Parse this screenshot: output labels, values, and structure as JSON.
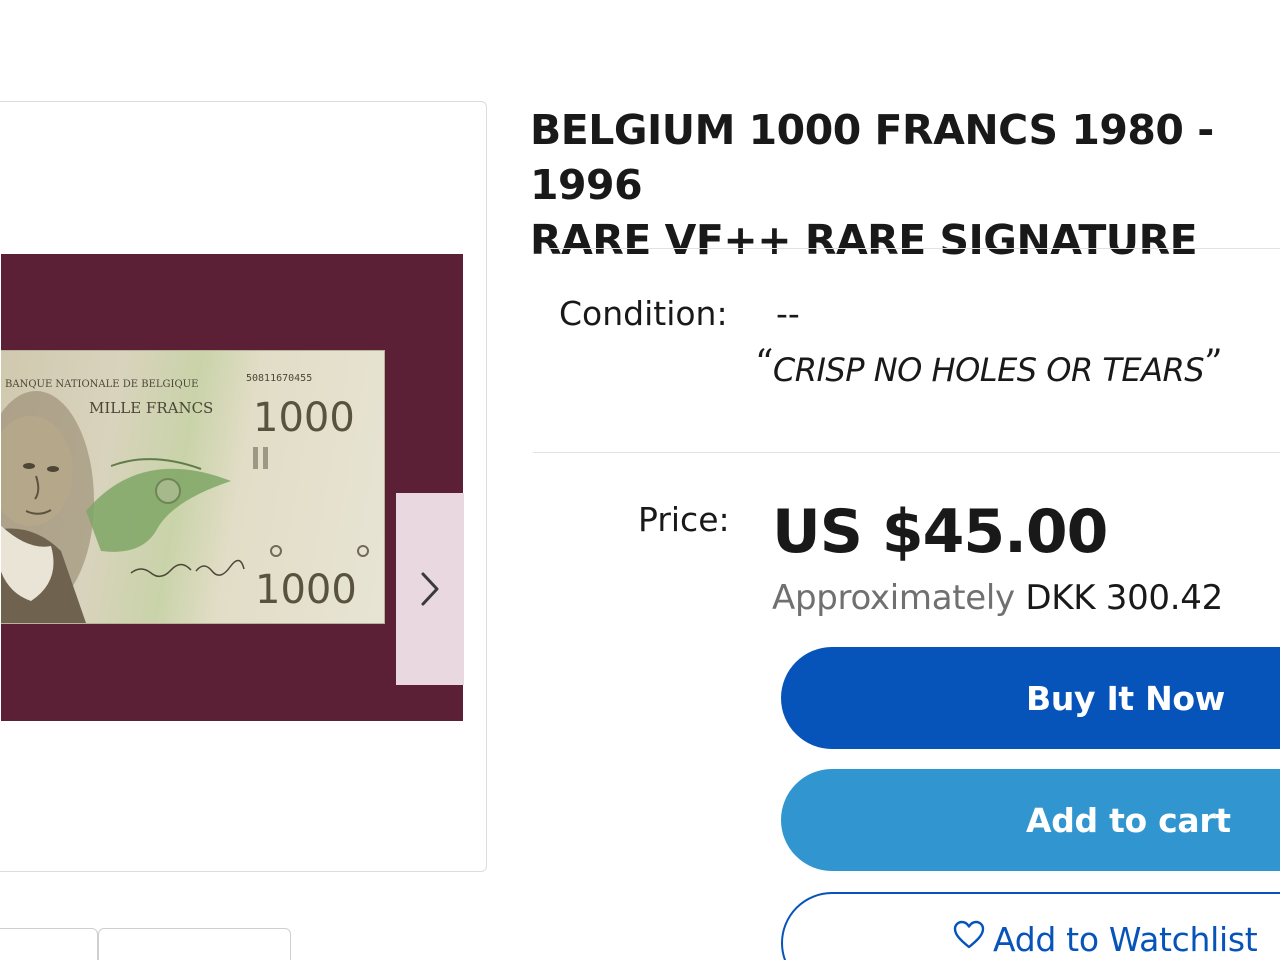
{
  "listing": {
    "title": "BELGIUM 1000 FRANCS 1980 - 1996\nRARE VF++ RARE SIGNATURE"
  },
  "gallery": {
    "next_icon": "chevron-right-icon",
    "banknote_text": {
      "bank_name": "BANQUE NATIONALE DE BELGIQUE",
      "denomination_words": "MILLE FRANCS",
      "serial": "50811670455",
      "value_top": "1000",
      "value_bottom": "1000"
    },
    "colors": {
      "backdrop": "#5c2036",
      "arrow_panel": "#ead8e0"
    }
  },
  "condition": {
    "label": "Condition:",
    "value": "--",
    "seller_note": "CRISP NO HOLES OR TEARS"
  },
  "price": {
    "label": "Price:",
    "value": "US $45.00",
    "approx_prefix": "Approximately",
    "approx_value": "DKK 300.42"
  },
  "actions": {
    "buy_now": "Buy It Now",
    "add_to_cart": "Add to cart",
    "add_to_watchlist": "Add to Watchlist",
    "watchlist_icon": "heart-icon"
  },
  "colors": {
    "buy_now": "#0654ba",
    "add_to_cart": "#3196d0",
    "watchlist_text": "#0654ba"
  }
}
